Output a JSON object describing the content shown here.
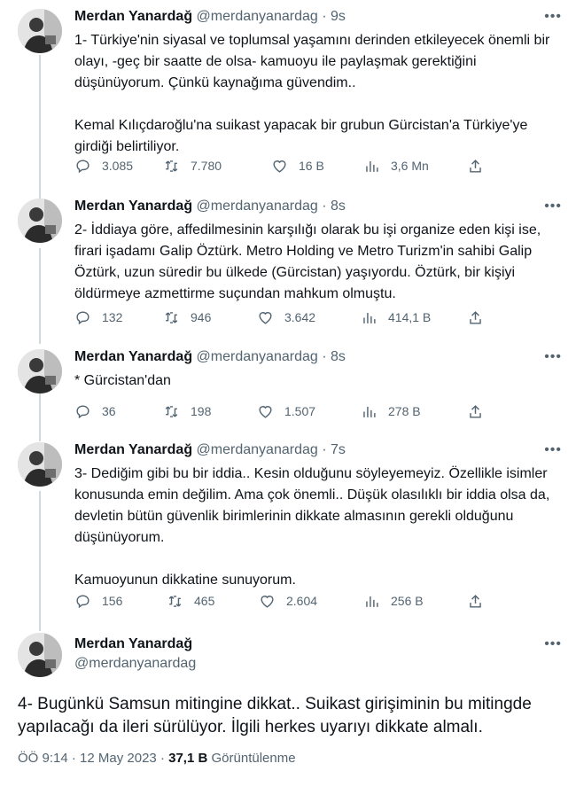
{
  "tweets": [
    {
      "name": "Merdan Yanardağ",
      "handle": "@merdanyanardag",
      "separator": "·",
      "time": "9s",
      "paragraphs": [
        "1- Türkiye'nin siyasal ve toplumsal yaşamını derinden etkileyecek önemli bir olayı, -geç bir saatte de olsa- kamuoyu ile paylaşmak gerektiğini düşünüyorum. Çünkü kaynağıma güvendim..",
        "Kemal Kılıçdaroğlu'na suikast yapacak bir grubun Gürcistan'a Türkiye'ye girdiği belirtiliyor."
      ],
      "replies": "3.085",
      "retweets": "7.780",
      "likes": "16 B",
      "views": "3,6 Mn"
    },
    {
      "name": "Merdan Yanardağ",
      "handle": "@merdanyanardag",
      "separator": "·",
      "time": "8s",
      "paragraphs": [
        "2- İddiaya göre, affedilmesinin karşılığı olarak bu işi organize eden kişi ise, firari işadamı Galip Öztürk.  Metro Holding ve Metro Turizm'in sahibi Galip Öztürk, uzun süredir bu ülkede (Gürcistan) yaşıyordu. Öztürk, bir kişiyi öldürmeye azmettirme suçundan mahkum olmuştu."
      ],
      "replies": "132",
      "retweets": "946",
      "likes": "3.642",
      "views": "414,1 B"
    },
    {
      "name": "Merdan Yanardağ",
      "handle": "@merdanyanardag",
      "separator": "·",
      "time": "8s",
      "paragraphs": [
        "* Gürcistan'dan"
      ],
      "replies": "36",
      "retweets": "198",
      "likes": "1.507",
      "views": "278 B"
    },
    {
      "name": "Merdan Yanardağ",
      "handle": "@merdanyanardag",
      "separator": "·",
      "time": "7s",
      "paragraphs": [
        "3- Dediğim gibi bu bir iddia.. Kesin olduğunu söyleyemeyiz. Özellikle isimler konusunda emin değilim. Ama çok önemli.. Düşük olasılıklı bir iddia olsa da, devletin bütün güvenlik birimlerinin dikkate almasının gerekli olduğunu düşünüyorum.",
        "Kamuoyunun dikkatine sunuyorum."
      ],
      "replies": "156",
      "retweets": "465",
      "likes": "2.604",
      "views": "256 B"
    }
  ],
  "focus": {
    "name": "Merdan Yanardağ",
    "handle": "@merdanyanardag",
    "text": "4- Bugünkü Samsun mitingine dikkat.. Suikast girişiminin bu mitingde yapılacağı da ileri sürülüyor. İlgili herkes uyarıyı dikkate almalı.",
    "time": "ÖÖ 9:14",
    "separator": "·",
    "date": "12 May 2023",
    "views_count": "37,1 B",
    "views_label": "Görüntülenme"
  },
  "icons": {
    "more": "more-dots-icon",
    "reply": "reply-icon",
    "retweet": "retweet-icon",
    "like": "heart-icon",
    "views": "views-chart-icon",
    "share": "share-icon"
  },
  "colors": {
    "text": "#0f1419",
    "secondary": "#536471",
    "thread_line": "#cfd9de"
  }
}
